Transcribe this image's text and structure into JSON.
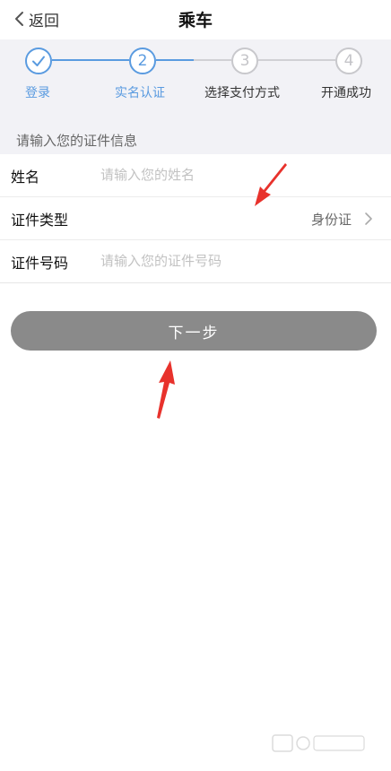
{
  "header": {
    "back_label": "返回",
    "title": "乘车"
  },
  "steps": [
    {
      "number": "✓",
      "label": "登录",
      "state": "done"
    },
    {
      "number": "2",
      "label": "实名认证",
      "state": "current"
    },
    {
      "number": "3",
      "label": "选择支付方式",
      "state": "pending"
    },
    {
      "number": "4",
      "label": "开通成功",
      "state": "pending"
    }
  ],
  "section_hint": "请输入您的证件信息",
  "form": {
    "name": {
      "label": "姓名",
      "placeholder": "请输入您的姓名"
    },
    "id_type": {
      "label": "证件类型",
      "value": "身份证"
    },
    "id_number": {
      "label": "证件号码",
      "placeholder": "请输入您的证件号码"
    }
  },
  "next_button": "下一步",
  "colors": {
    "accent": "#5a9be0",
    "button": "#8a8a8a",
    "annotation": "#e8322c"
  }
}
